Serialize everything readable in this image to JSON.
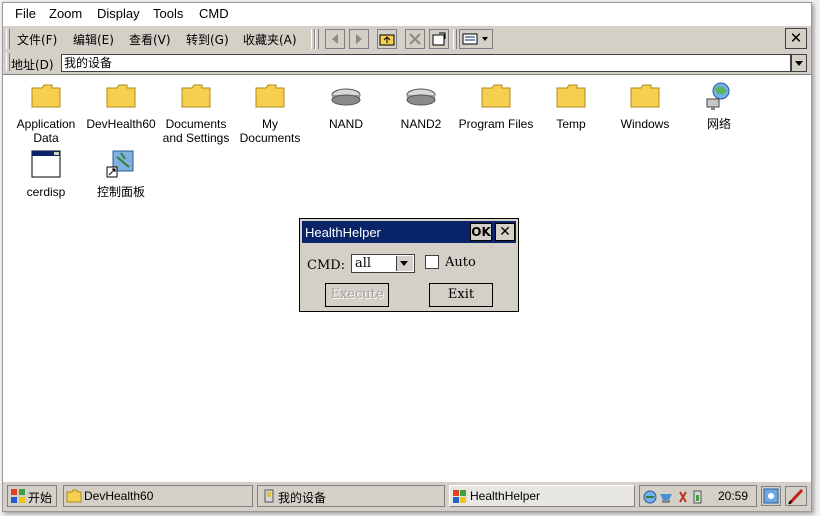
{
  "host_menu": [
    "File",
    "Zoom",
    "Display",
    "Tools",
    "CMD"
  ],
  "ce_menu": [
    "文件(F)",
    "编辑(E)",
    "查看(V)",
    "转到(G)",
    "收藏夹(A)"
  ],
  "address": {
    "label": "地址(D)",
    "value": "我的设备"
  },
  "icons": [
    {
      "name": "Application Data",
      "type": "folder"
    },
    {
      "name": "DevHealth60",
      "type": "folder"
    },
    {
      "name": "Documents and Settings",
      "type": "folder"
    },
    {
      "name": "My Documents",
      "type": "folder"
    },
    {
      "name": "NAND",
      "type": "drive"
    },
    {
      "name": "NAND2",
      "type": "drive"
    },
    {
      "name": "Program Files",
      "type": "folder"
    },
    {
      "name": "Temp",
      "type": "folder"
    },
    {
      "name": "Windows",
      "type": "folder"
    },
    {
      "name": "网络",
      "type": "network"
    },
    {
      "name": "cerdisp",
      "type": "app"
    },
    {
      "name": "控制面板",
      "type": "control-panel"
    }
  ],
  "dialog": {
    "title": "HealthHelper",
    "ok": "OK",
    "close": "✕",
    "cmd_label": "CMD:",
    "cmd_value": "all",
    "auto_label": "Auto",
    "execute": "Execute",
    "exit": "Exit"
  },
  "taskbar": {
    "start": "开始",
    "tasks": [
      "DevHealth60",
      "我的设备",
      "HealthHelper"
    ],
    "time": "20:59"
  },
  "colors": {
    "title_bar": "#0a246a",
    "chrome": "#d4d0c8",
    "folder": "#f5cf4d"
  }
}
